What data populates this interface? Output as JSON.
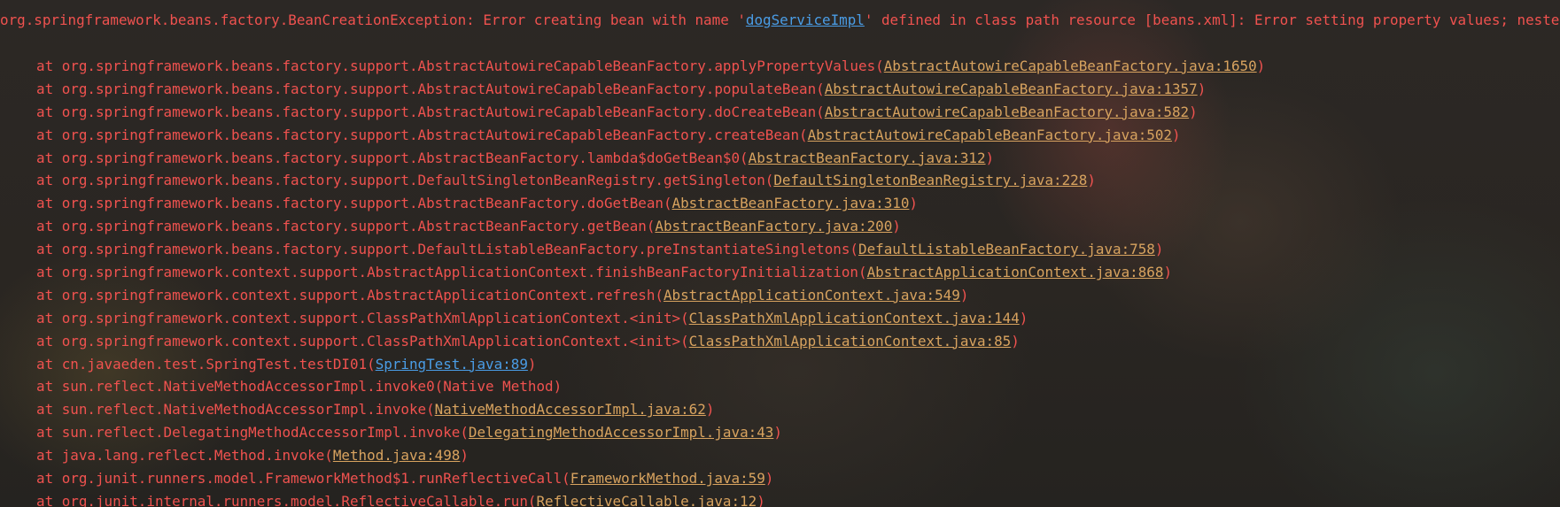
{
  "exception": {
    "prefix": "org.springframework.beans.factory.BeanCreationException: Error creating bean with name '",
    "bean_name": "dogServiceImpl",
    "suffix": "' defined in class path resource [beans.xml]: Error setting property values; nested exception is org.springframework.beans.NotWritablePropertyException: Invalid property 'ageDog' of bean class"
  },
  "frames": [
    {
      "method": "at org.springframework.beans.factory.support.AbstractAutowireCapableBeanFactory.applyPropertyValues(",
      "source": "AbstractAutowireCapableBeanFactory.java:1650",
      "close": ")"
    },
    {
      "method": "at org.springframework.beans.factory.support.AbstractAutowireCapableBeanFactory.populateBean(",
      "source": "AbstractAutowireCapableBeanFactory.java:1357",
      "close": ")"
    },
    {
      "method": "at org.springframework.beans.factory.support.AbstractAutowireCapableBeanFactory.doCreateBean(",
      "source": "AbstractAutowireCapableBeanFactory.java:582",
      "close": ")"
    },
    {
      "method": "at org.springframework.beans.factory.support.AbstractAutowireCapableBeanFactory.createBean(",
      "source": "AbstractAutowireCapableBeanFactory.java:502",
      "close": ")"
    },
    {
      "method": "at org.springframework.beans.factory.support.AbstractBeanFactory.lambda$doGetBean$0(",
      "source": "AbstractBeanFactory.java:312",
      "close": ")"
    },
    {
      "method": "at org.springframework.beans.factory.support.DefaultSingletonBeanRegistry.getSingleton(",
      "source": "DefaultSingletonBeanRegistry.java:228",
      "close": ")"
    },
    {
      "method": "at org.springframework.beans.factory.support.AbstractBeanFactory.doGetBean(",
      "source": "AbstractBeanFactory.java:310",
      "close": ")"
    },
    {
      "method": "at org.springframework.beans.factory.support.AbstractBeanFactory.getBean(",
      "source": "AbstractBeanFactory.java:200",
      "close": ")"
    },
    {
      "method": "at org.springframework.beans.factory.support.DefaultListableBeanFactory.preInstantiateSingletons(",
      "source": "DefaultListableBeanFactory.java:758",
      "close": ")"
    },
    {
      "method": "at org.springframework.context.support.AbstractApplicationContext.finishBeanFactoryInitialization(",
      "source": "AbstractApplicationContext.java:868",
      "close": ")"
    },
    {
      "method": "at org.springframework.context.support.AbstractApplicationContext.refresh(",
      "source": "AbstractApplicationContext.java:549",
      "close": ")"
    },
    {
      "method": "at org.springframework.context.support.ClassPathXmlApplicationContext.<init>(",
      "source": "ClassPathXmlApplicationContext.java:144",
      "close": ")"
    },
    {
      "method": "at org.springframework.context.support.ClassPathXmlApplicationContext.<init>(",
      "source": "ClassPathXmlApplicationContext.java:85",
      "close": ")"
    },
    {
      "method": "at cn.javaeden.test.SpringTest.testDI01(",
      "source": "SpringTest.java:89",
      "close": ")",
      "user_code": true
    },
    {
      "method": "at sun.reflect.NativeMethodAccessorImpl.invoke0(Native Method)",
      "source": "",
      "close": ""
    },
    {
      "method": "at sun.reflect.NativeMethodAccessorImpl.invoke(",
      "source": "NativeMethodAccessorImpl.java:62",
      "close": ")"
    },
    {
      "method": "at sun.reflect.DelegatingMethodAccessorImpl.invoke(",
      "source": "DelegatingMethodAccessorImpl.java:43",
      "close": ")"
    },
    {
      "method": "at java.lang.reflect.Method.invoke(",
      "source": "Method.java:498",
      "close": ")"
    },
    {
      "method": "at org.junit.runners.model.FrameworkMethod$1.runReflectiveCall(",
      "source": "FrameworkMethod.java:59",
      "close": ")"
    },
    {
      "method": "at org.junit.internal.runners.model.ReflectiveCallable.run(",
      "source": "ReflectiveCallable.java:12",
      "close": ")"
    }
  ],
  "colors": {
    "background": "#2a2724",
    "error_text": "#f0524f",
    "source_link": "#d8a35f",
    "user_code_link": "#4a9de6"
  }
}
